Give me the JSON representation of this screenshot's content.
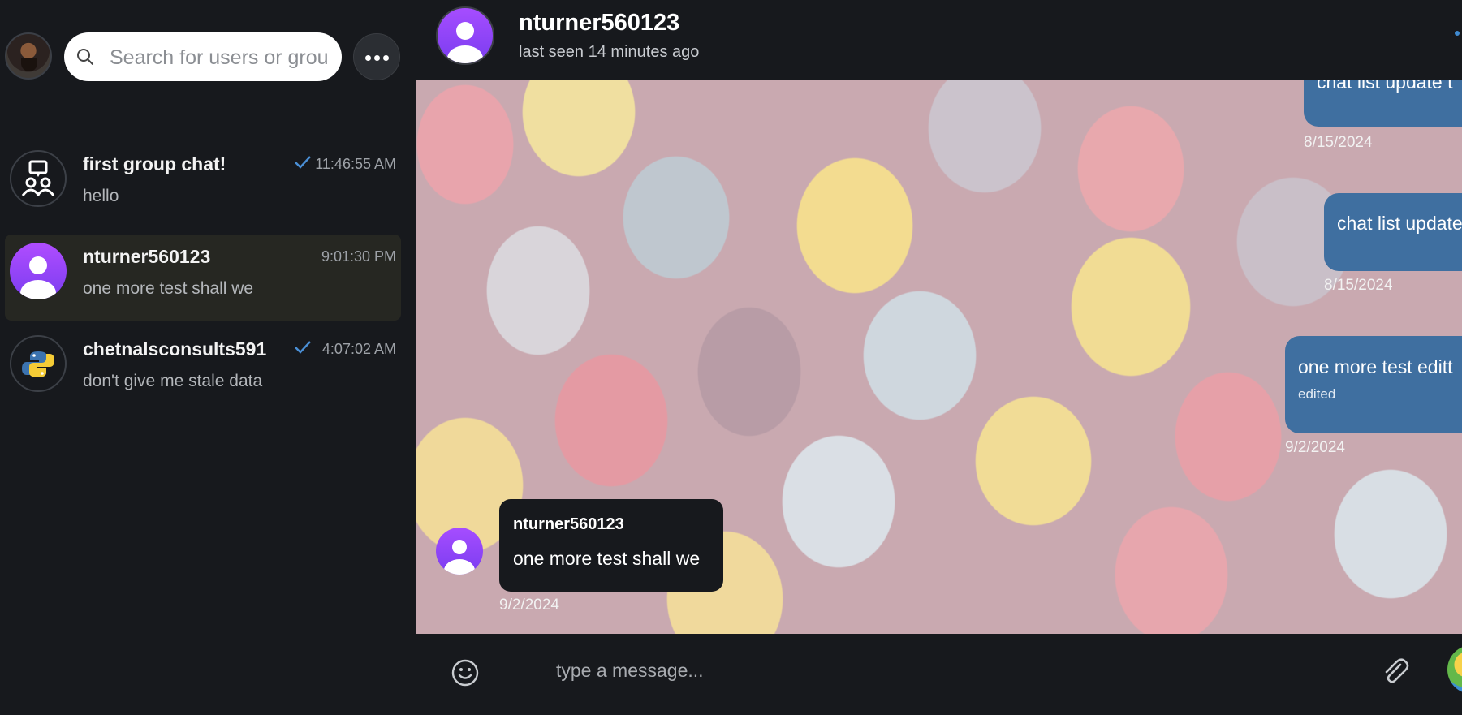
{
  "sidebar": {
    "search_placeholder": "Search for users or groups",
    "chats": [
      {
        "name": "first group chat!",
        "preview": "hello",
        "time": "11:46:55 AM",
        "read": true,
        "avatar": "group-icon"
      },
      {
        "name": "nturner560123",
        "preview": "one more test shall we",
        "time": "9:01:30 PM",
        "read": false,
        "avatar": "user-icon",
        "active": true
      },
      {
        "name": "chetnalsconsults591",
        "preview": "don't give me stale data",
        "time": "4:07:02 AM",
        "read": true,
        "avatar": "python-logo"
      }
    ]
  },
  "header": {
    "name": "nturner560123",
    "status": "last seen 14 minutes ago"
  },
  "messages": [
    {
      "direction": "out",
      "text": "chat list update t",
      "date": "8/15/2024"
    },
    {
      "direction": "out",
      "text": "chat list update",
      "date": "8/15/2024"
    },
    {
      "direction": "out",
      "text": "one more test editt",
      "edited": "edited",
      "date": "9/2/2024"
    },
    {
      "direction": "in",
      "sender": "nturner560123",
      "text": "one more test shall we",
      "date": "9/2/2024"
    }
  ],
  "composer": {
    "placeholder": "type a message..."
  },
  "colors": {
    "background": "#17191d",
    "outgoing_bubble": "#3f6fa0",
    "active_chat": "#262722",
    "avatar_purple": "#a64dff"
  }
}
